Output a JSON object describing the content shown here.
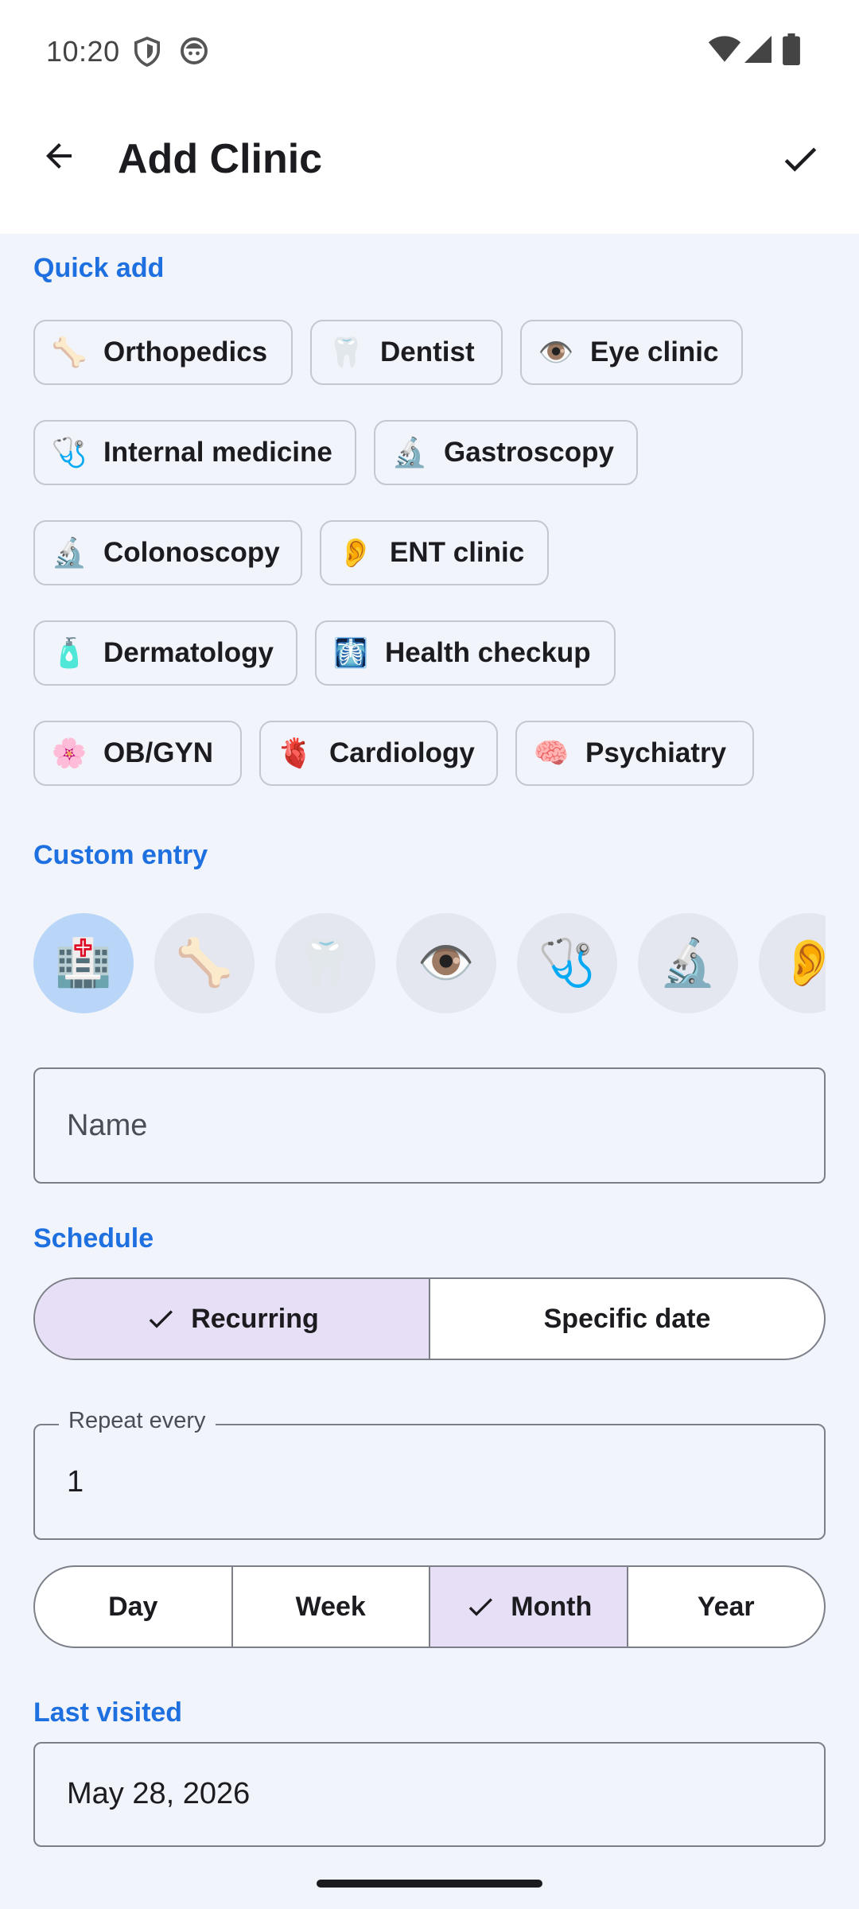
{
  "status_bar": {
    "time": "10:20",
    "left_icons": [
      "shield-icon",
      "face-icon"
    ],
    "right_icons": [
      "wifi-icon",
      "cellular-icon",
      "battery-icon"
    ]
  },
  "app_bar": {
    "title": "Add Clinic",
    "back_icon": "arrow-left-icon",
    "confirm_icon": "check-icon"
  },
  "quick_add": {
    "title": "Quick add",
    "chips": [
      {
        "emoji": "🦴",
        "label": "Orthopedics"
      },
      {
        "emoji": "🦷",
        "label": "Dentist"
      },
      {
        "emoji": "👁️",
        "label": "Eye clinic"
      },
      {
        "emoji": "🩺",
        "label": "Internal medicine"
      },
      {
        "emoji": "🔬",
        "label": "Gastroscopy"
      },
      {
        "emoji": "🔬",
        "label": "Colonoscopy"
      },
      {
        "emoji": "👂",
        "label": "ENT clinic"
      },
      {
        "emoji": "🧴",
        "label": "Dermatology"
      },
      {
        "emoji": "🩻",
        "label": "Health checkup"
      },
      {
        "emoji": "🌸",
        "label": "OB/GYN"
      },
      {
        "emoji": "🫀",
        "label": "Cardiology"
      },
      {
        "emoji": "🧠",
        "label": "Psychiatry"
      }
    ]
  },
  "custom_entry": {
    "title": "Custom entry",
    "icons": [
      {
        "emoji": "🏥",
        "selected": true
      },
      {
        "emoji": "🦴",
        "selected": false
      },
      {
        "emoji": "🦷",
        "selected": false
      },
      {
        "emoji": "👁️",
        "selected": false
      },
      {
        "emoji": "🩺",
        "selected": false
      },
      {
        "emoji": "🔬",
        "selected": false
      },
      {
        "emoji": "👂",
        "selected": false
      }
    ],
    "name_placeholder": "Name"
  },
  "schedule": {
    "title": "Schedule",
    "mode_options": [
      {
        "label": "Recurring",
        "selected": true
      },
      {
        "label": "Specific date",
        "selected": false
      }
    ],
    "repeat_every_label": "Repeat every",
    "repeat_every_value": "1",
    "unit_options": [
      {
        "label": "Day",
        "selected": false
      },
      {
        "label": "Week",
        "selected": false
      },
      {
        "label": "Month",
        "selected": true
      },
      {
        "label": "Year",
        "selected": false
      }
    ]
  },
  "last_visited": {
    "title": "Last visited",
    "value": "May 28, 2026"
  },
  "colors": {
    "accent": "#1e6fe0",
    "selected_segment": "#e7dff5",
    "selected_icon": "#b9d6f8",
    "background": "#f1f4fb"
  }
}
